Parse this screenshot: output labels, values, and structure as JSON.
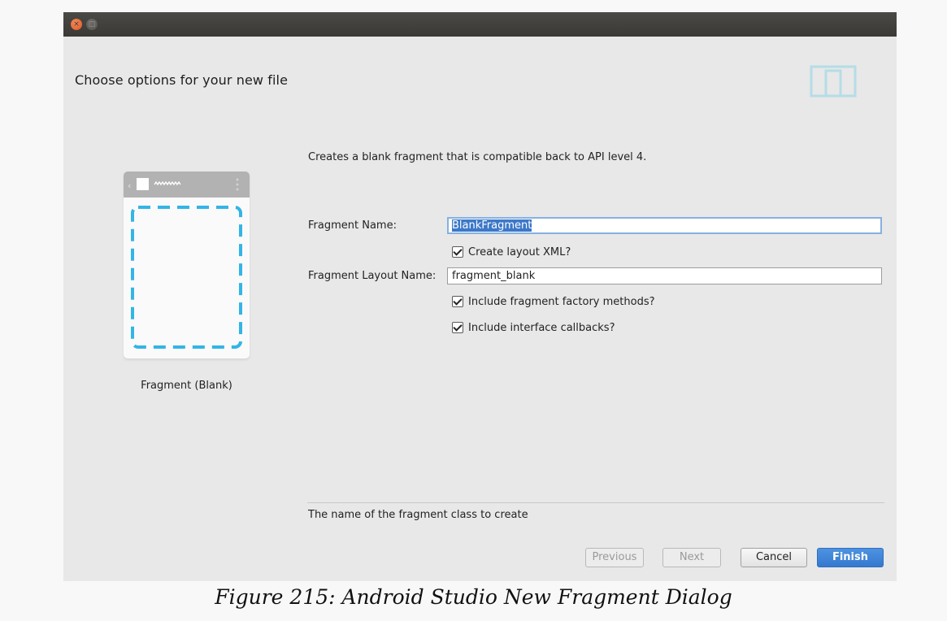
{
  "window": {
    "close_glyph": "×",
    "maximize_glyph": "□"
  },
  "header": {
    "title": "Choose options for your new file",
    "icon": "device-tablet-phone-icon",
    "icon_color": "#b5dde6"
  },
  "template_preview": {
    "label": "Fragment (Blank)",
    "accent_color": "#33b5e5"
  },
  "form": {
    "description": "Creates a blank fragment that is compatible back to API level 4.",
    "fragment_name_label": "Fragment Name:",
    "fragment_name_value": "BlankFragment",
    "create_layout_xml_label": "Create layout XML?",
    "create_layout_xml_checked": true,
    "fragment_layout_name_label": "Fragment Layout Name:",
    "fragment_layout_name_value": "fragment_blank",
    "include_factory_methods_label": "Include fragment factory methods?",
    "include_factory_methods_checked": true,
    "include_interface_callbacks_label": "Include interface callbacks?",
    "include_interface_callbacks_checked": true
  },
  "footer": {
    "hint": "The name of the fragment class to create",
    "previous_label": "Previous",
    "next_label": "Next",
    "cancel_label": "Cancel",
    "finish_label": "Finish"
  },
  "caption": "Figure 215: Android Studio New Fragment Dialog"
}
